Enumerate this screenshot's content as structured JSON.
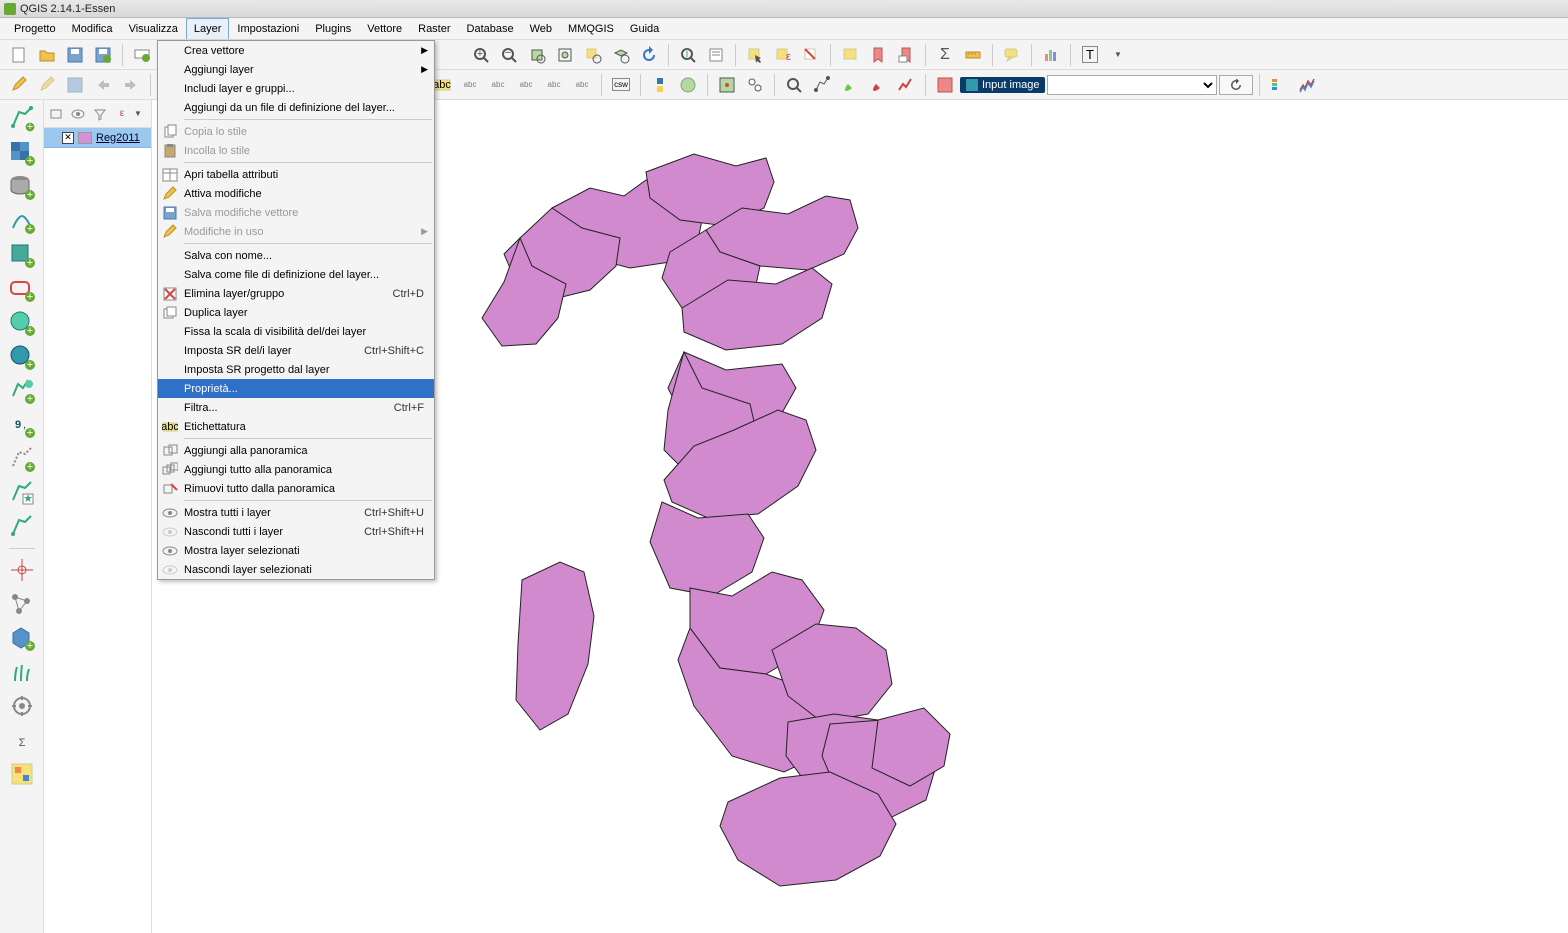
{
  "app": {
    "title": "QGIS 2.14.1-Essen"
  },
  "menubar": [
    "Progetto",
    "Modifica",
    "Visualizza",
    "Layer",
    "Impostazioni",
    "Plugins",
    "Vettore",
    "Raster",
    "Database",
    "Web",
    "MMQGIS",
    "Guida"
  ],
  "menubar_open_index": 3,
  "dropdown": {
    "highlighted": "Proprietà...",
    "items": [
      {
        "label": "Crea vettore",
        "submenu": true
      },
      {
        "label": "Aggiungi layer",
        "submenu": true
      },
      {
        "label": "Includi layer e gruppi..."
      },
      {
        "label": "Aggiungi da un file di definizione del layer..."
      },
      {
        "sep": true
      },
      {
        "label": "Copia lo stile",
        "icon": "copy",
        "disabled": true
      },
      {
        "label": "Incolla lo stile",
        "icon": "paste",
        "disabled": true
      },
      {
        "sep": true
      },
      {
        "label": "Apri tabella attributi",
        "icon": "table"
      },
      {
        "label": "Attiva modifiche",
        "icon": "pencil"
      },
      {
        "label": "Salva modifiche vettore",
        "icon": "save",
        "disabled": true
      },
      {
        "label": "Modifiche in uso",
        "submenu": true,
        "disabled": true,
        "icon": "pencil"
      },
      {
        "sep": true
      },
      {
        "label": "Salva con nome..."
      },
      {
        "label": "Salva come file di definizione del layer..."
      },
      {
        "label": "Elimina layer/gruppo",
        "icon": "delete",
        "shortcut": "Ctrl+D"
      },
      {
        "label": "Duplica layer",
        "icon": "duplicate"
      },
      {
        "label": "Fissa la scala di visibilità del/dei layer"
      },
      {
        "label": "Imposta SR del/i layer",
        "shortcut": "Ctrl+Shift+C"
      },
      {
        "label": "Imposta SR progetto dal layer"
      },
      {
        "label": "Proprietà..."
      },
      {
        "label": "Filtra...",
        "shortcut": "Ctrl+F"
      },
      {
        "label": "Etichettatura",
        "icon": "label"
      },
      {
        "sep": true
      },
      {
        "label": "Aggiungi alla panoramica",
        "icon": "overview-add"
      },
      {
        "label": "Aggiungi tutto alla panoramica",
        "icon": "overview-add-all"
      },
      {
        "label": "Rimuovi tutto dalla panoramica",
        "icon": "overview-remove"
      },
      {
        "sep": true
      },
      {
        "label": "Mostra tutti i layer",
        "icon": "eye",
        "shortcut": "Ctrl+Shift+U"
      },
      {
        "label": "Nascondi tutti i layer",
        "icon": "eye-off",
        "shortcut": "Ctrl+Shift+H"
      },
      {
        "label": "Mostra layer selezionati",
        "icon": "eye"
      },
      {
        "label": "Nascondi layer selezionati",
        "icon": "eye-off"
      }
    ]
  },
  "toolbar2_input_label": "Input image",
  "layers_panel": {
    "items": [
      {
        "checked": true,
        "color": "#d691d6",
        "name": "Reg2011"
      }
    ]
  },
  "lefttool_icons": [
    "add-vector-layer",
    "add-raster-layer",
    "add-postgis-layer",
    "add-spatialite-layer",
    "add-mssql-layer",
    "add-oracle-layer",
    "add-wms-layer",
    "add-wcs-layer",
    "add-wfs-layer",
    "add-delimited-text",
    "add-virtual-layer",
    "new-shapefile",
    "new-spatialite",
    "sep",
    "crosshair",
    "nodes",
    "polygon-add",
    "grass",
    "processing",
    "sum",
    "stylemanager"
  ],
  "map_fill": "#d18ace",
  "map_stroke": "#222"
}
